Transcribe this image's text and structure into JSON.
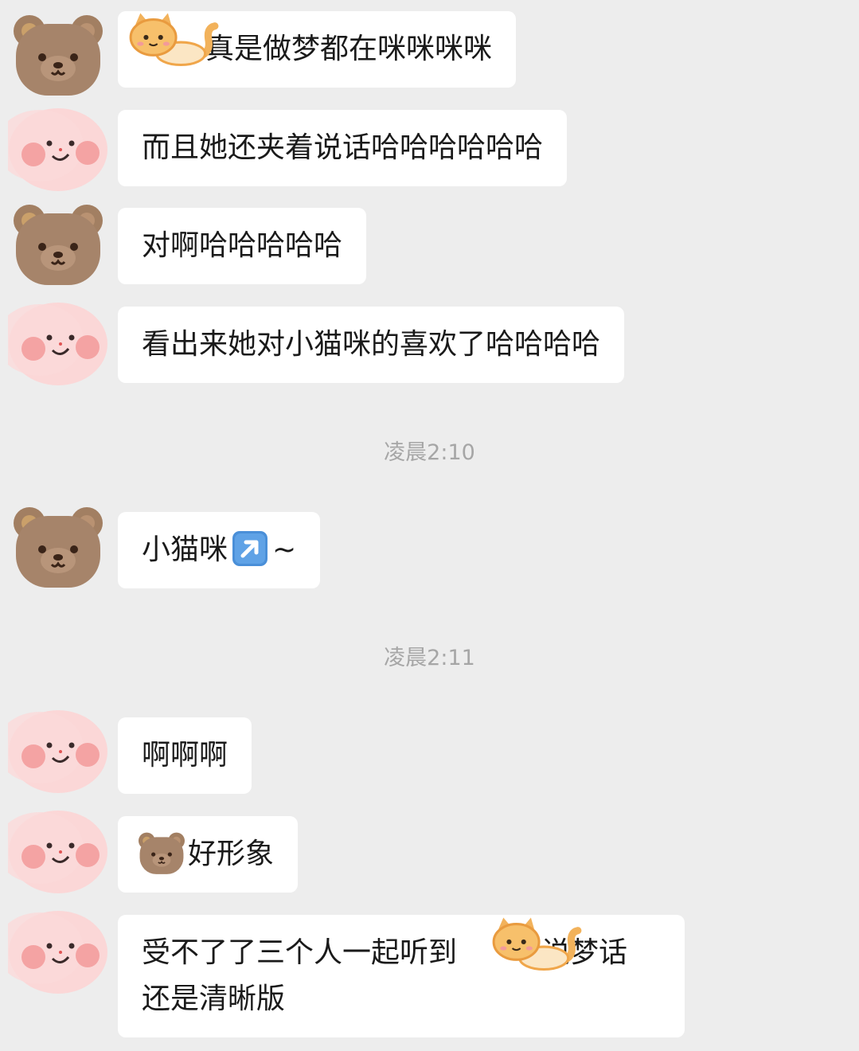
{
  "messages": [
    {
      "sender": "bear",
      "text": "真是做梦都在咪咪咪咪"
    },
    {
      "sender": "bunny",
      "text": "而且她还夹着说话哈哈哈哈哈哈"
    },
    {
      "sender": "bear",
      "text": "对啊哈哈哈哈哈"
    },
    {
      "sender": "bunny",
      "text": "看出来她对小猫咪的喜欢了哈哈哈哈"
    },
    {
      "sender": "bear",
      "text": "小猫咪",
      "suffix": "~",
      "emoji": "arrow-up-right-emoji"
    },
    {
      "sender": "bunny",
      "text": "啊啊啊"
    },
    {
      "sender": "bunny",
      "text": "好形象",
      "emoji": "bear-face-emoji"
    },
    {
      "sender": "bunny",
      "text_line1_start": "受不了了三个人一起听到",
      "text_line1_end": "说梦话",
      "text_line2": "还是清晰版"
    }
  ],
  "timestamps": [
    "凌晨2:10",
    "凌晨2:11"
  ],
  "colors": {
    "background": "#ededed",
    "bubble": "#ffffff",
    "text": "#1a1a1a",
    "timestamp": "#a6a6a6"
  }
}
